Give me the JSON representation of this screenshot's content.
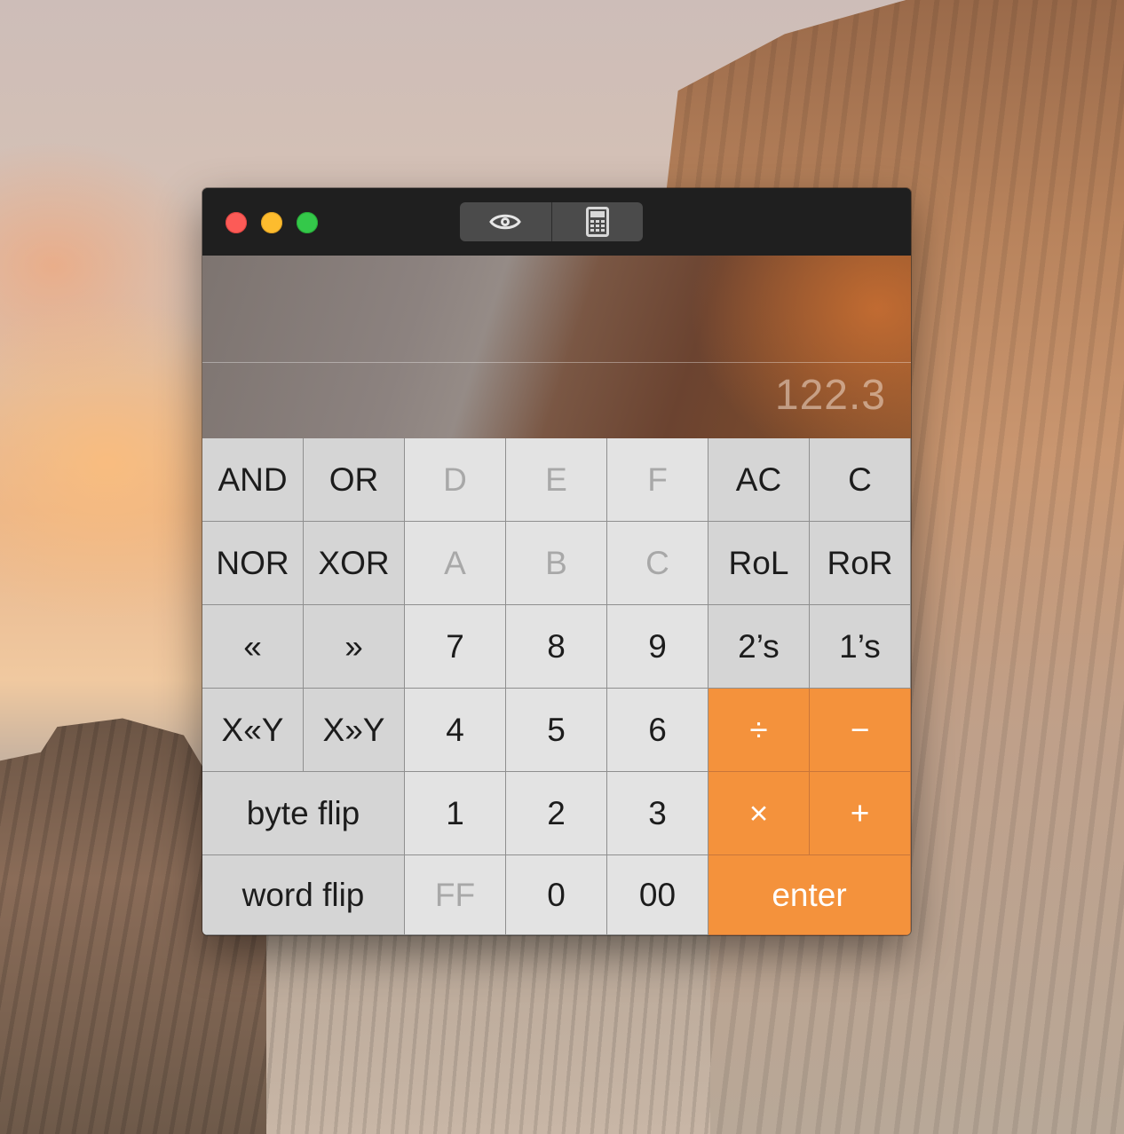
{
  "window": {
    "toolbar": {
      "segments": [
        {
          "icon": "eye-icon"
        },
        {
          "icon": "calculator-icon"
        }
      ]
    }
  },
  "display": {
    "value": "122.3"
  },
  "keypad": {
    "row1": [
      "AND",
      "OR",
      "D",
      "E",
      "F",
      "AC",
      "C"
    ],
    "row2": [
      "NOR",
      "XOR",
      "A",
      "B",
      "C",
      "RoL",
      "RoR"
    ],
    "row3": [
      "«",
      "»",
      "7",
      "8",
      "9",
      "2’s",
      "1’s"
    ],
    "row4": [
      "X«Y",
      "X»Y",
      "4",
      "5",
      "6",
      "÷",
      "−"
    ],
    "row5": [
      "byte flip",
      "1",
      "2",
      "3",
      "×",
      "+"
    ],
    "row6": [
      "word flip",
      "FF",
      "0",
      "00",
      "enter"
    ]
  },
  "colors": {
    "accent": "#f4923c",
    "function_key": "#d5d5d5",
    "number_key": "#e3e3e3",
    "disabled_text": "#a8a8a8",
    "titlebar": "#1f1f1f"
  }
}
